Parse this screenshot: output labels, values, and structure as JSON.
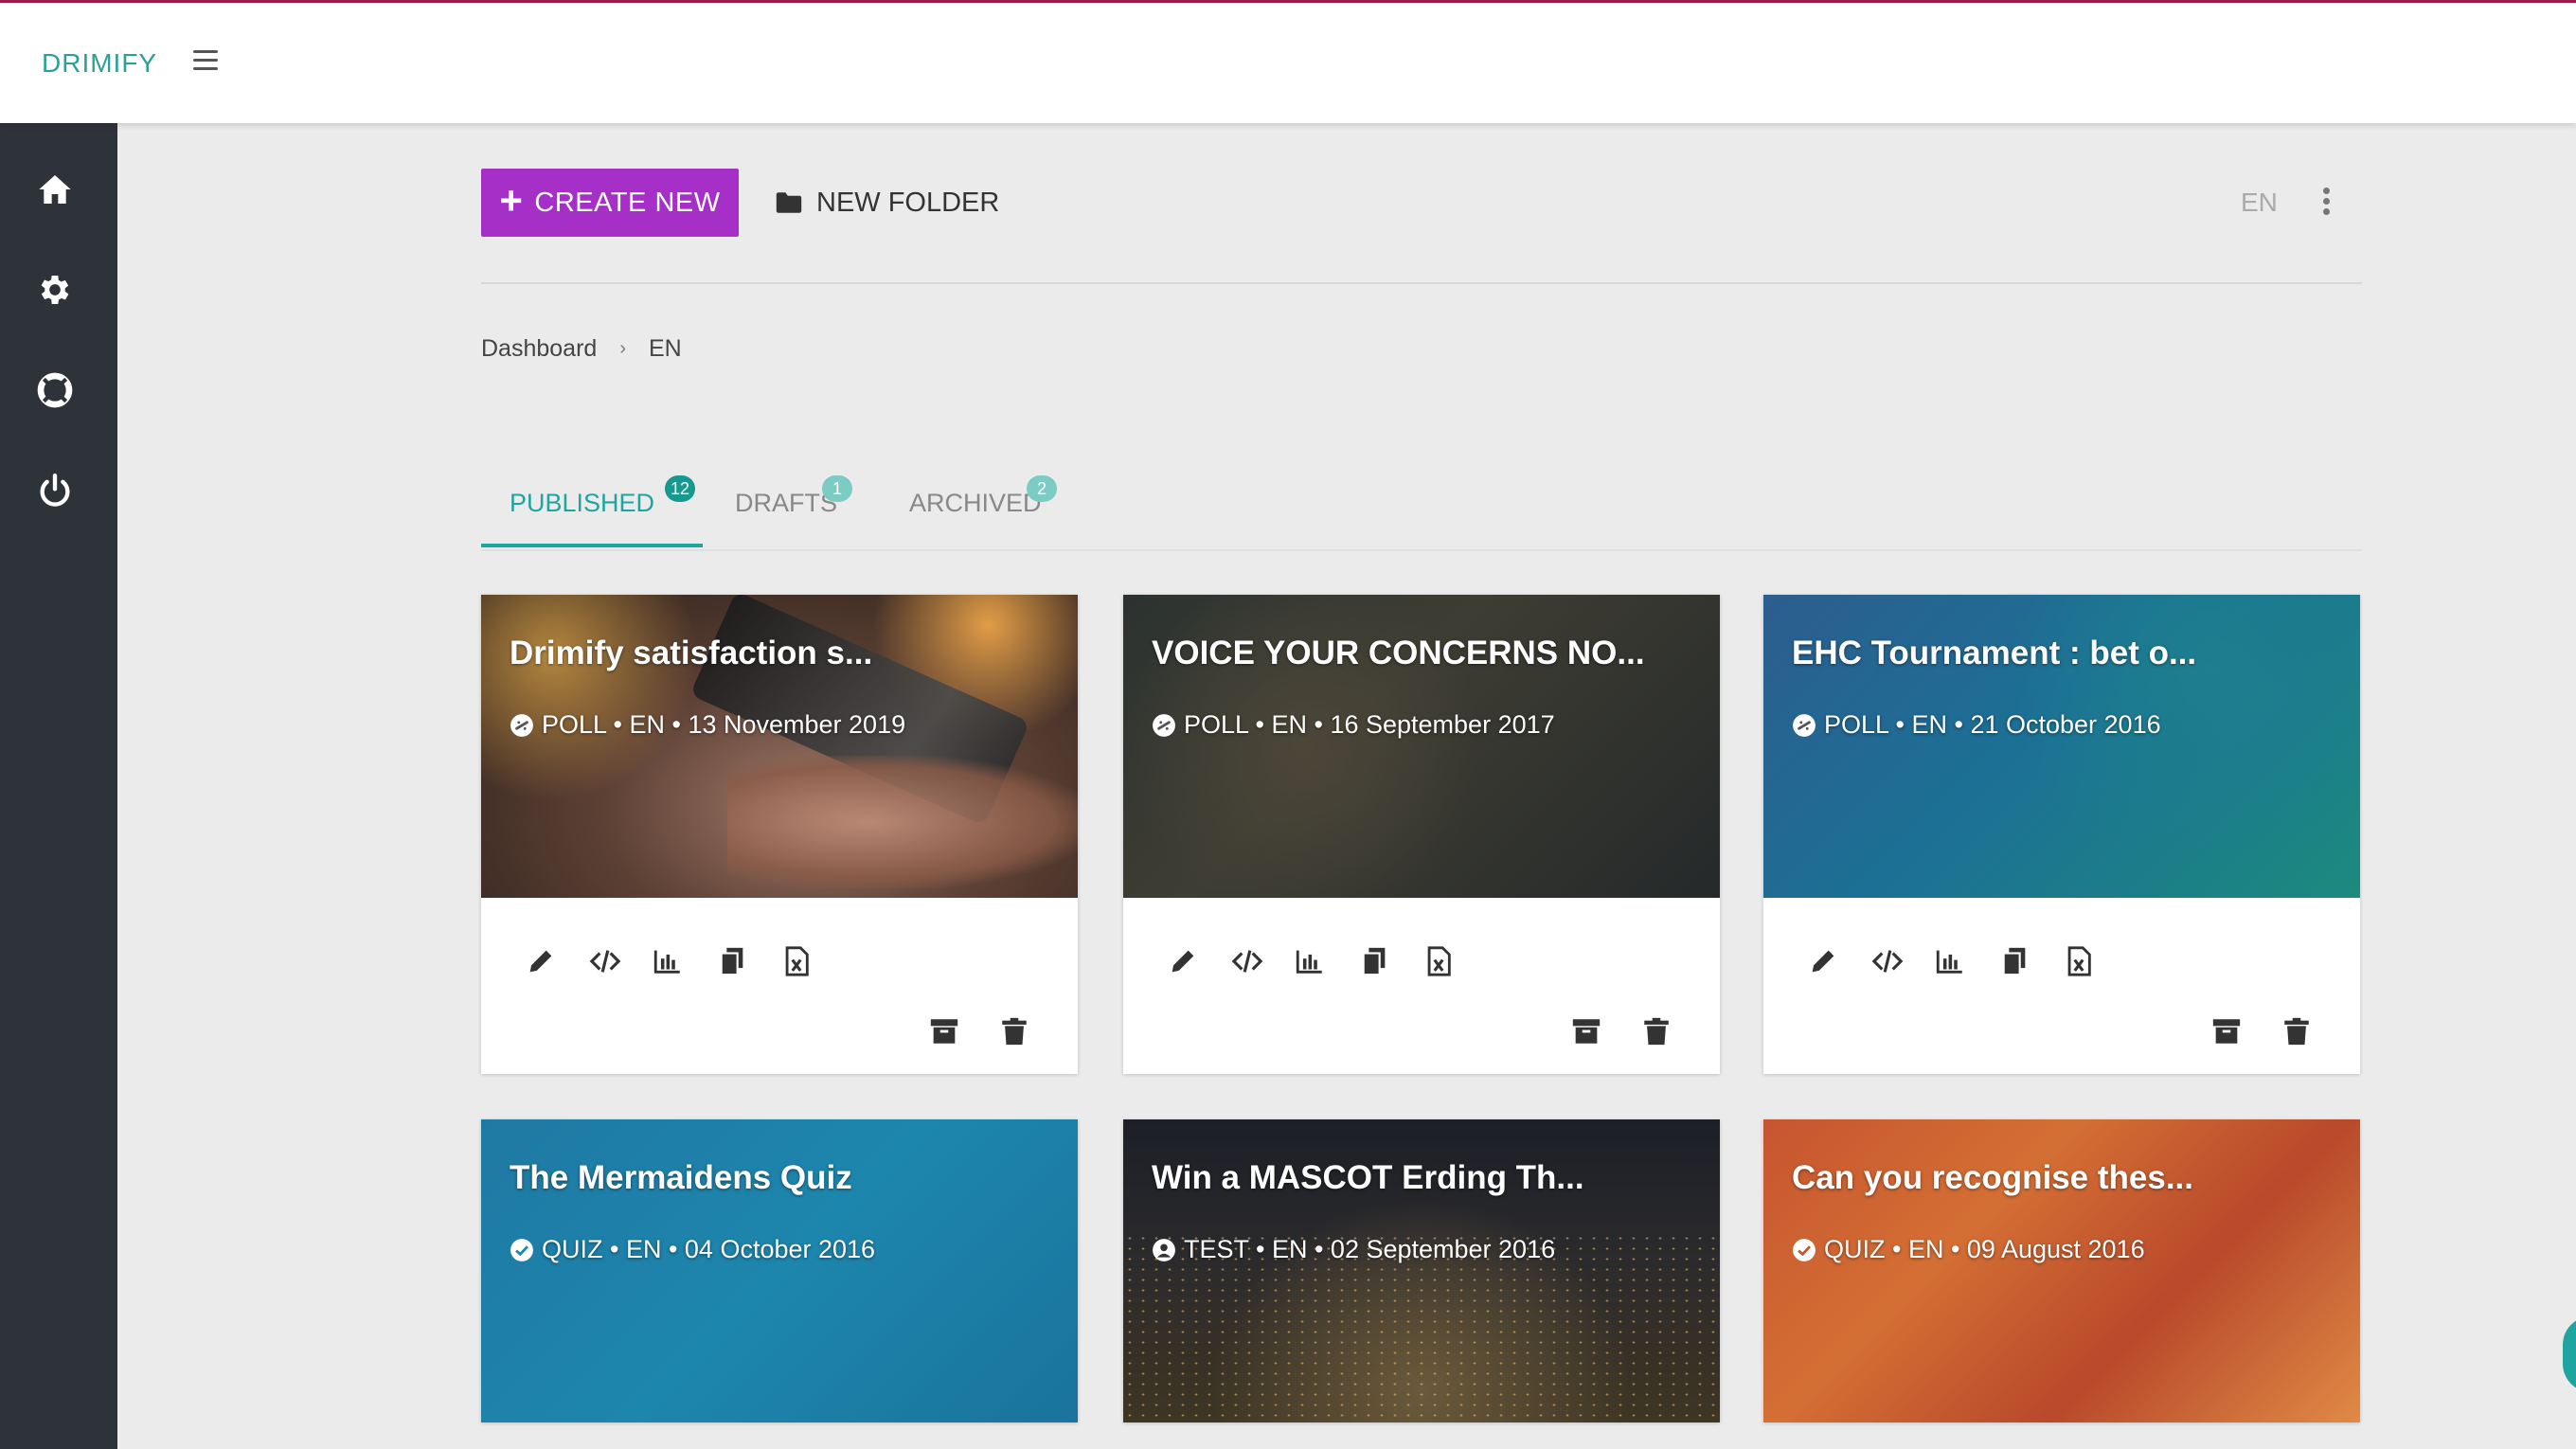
{
  "app": {
    "logo": "DRIMIFY"
  },
  "toolbar": {
    "create_label": "CREATE NEW",
    "folder_label": "NEW FOLDER",
    "language": "EN"
  },
  "breadcrumb": {
    "root": "Dashboard",
    "separator": "›",
    "current": "EN"
  },
  "tabs": [
    {
      "label": "PUBLISHED",
      "count": "12"
    },
    {
      "label": "DRAFTS",
      "count": "1"
    },
    {
      "label": "ARCHIVED",
      "count": "2"
    }
  ],
  "cards": [
    {
      "title": "Drimify satisfaction s...",
      "meta": "POLL • EN • 13 November 2019",
      "type_icon": "poll-icon"
    },
    {
      "title": "VOICE YOUR CONCERNS NO...",
      "meta": "POLL • EN • 16 September 2017",
      "type_icon": "poll-icon"
    },
    {
      "title": "EHC Tournament : bet o...",
      "meta": "POLL • EN • 21 October 2016",
      "type_icon": "poll-icon"
    },
    {
      "title": "The Mermaidens Quiz",
      "meta": "QUIZ • EN • 04 October 2016",
      "type_icon": "check-circle-icon"
    },
    {
      "title": "Win a MASCOT Erding Th...",
      "meta": "TEST • EN • 02 September 2016",
      "type_icon": "user-circle-icon"
    },
    {
      "title": "Can you recognise thes...",
      "meta": "QUIZ • EN • 09 August 2016",
      "type_icon": "check-circle-icon"
    }
  ],
  "colors": {
    "accent": "#a62fc8",
    "teal": "#1fa5a0",
    "sidebar": "#2e333a"
  }
}
